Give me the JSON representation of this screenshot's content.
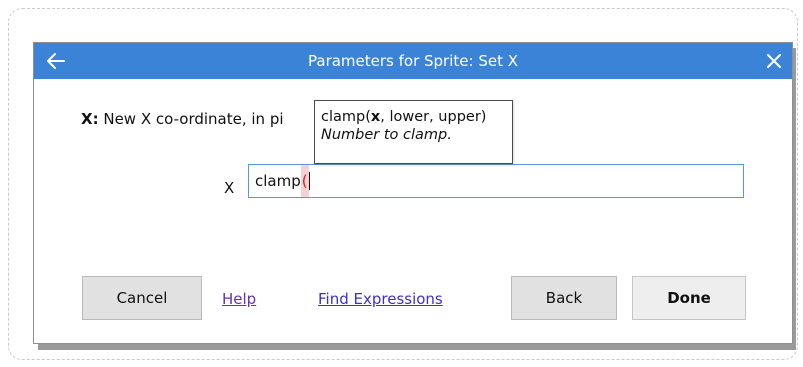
{
  "dialog": {
    "title": "Parameters for Sprite: Set X",
    "parameter": {
      "name": "X:",
      "description": " New X co-ordinate, in pi",
      "label": "X"
    },
    "tooltip": {
      "signature_prefix": "clamp(",
      "signature_param": "x",
      "signature_suffix": ", lower, upper)",
      "doc": "Number to clamp."
    },
    "input": {
      "value_text": "clamp",
      "value_paren": "("
    },
    "buttons": {
      "cancel": "Cancel",
      "help": "Help",
      "find_expressions": "Find Expressions",
      "back": "Back",
      "done": "Done"
    }
  },
  "icons": {
    "back": "back-arrow-icon",
    "close": "close-icon"
  },
  "colors": {
    "titlebar": "#3b83d7",
    "input_border": "#5b97d8",
    "paren_error": "#d62020",
    "link": "#3c2fd1",
    "visited_link": "#6a2fb0"
  }
}
